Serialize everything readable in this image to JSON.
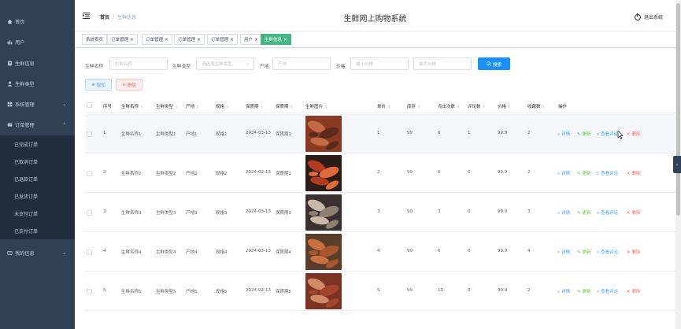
{
  "sidebar": {
    "items": [
      {
        "label": "首页",
        "icon": "home-icon"
      },
      {
        "label": "用户",
        "icon": "user-group-icon"
      },
      {
        "label": "生鲜信息",
        "icon": "document-icon"
      },
      {
        "label": "生鲜类型",
        "icon": "person-icon"
      },
      {
        "label": "系统管理",
        "icon": "grid-icon"
      },
      {
        "label": "订单管理",
        "icon": "order-icon"
      }
    ],
    "order_sub": [
      "已完成订单",
      "已取消订单",
      "已退款订单",
      "已发货订单",
      "未支付订单",
      "已支付订单"
    ],
    "my_info": "我的信息"
  },
  "header": {
    "breadcrumb_home": "首页",
    "breadcrumb_current": "生鲜信息",
    "title": "生鲜网上购物系统",
    "logout": "退出系统"
  },
  "tags": [
    "系统首页",
    "订单管理",
    "订单管理",
    "订单管理",
    "订单管理",
    "用户",
    "生鲜信息"
  ],
  "search": {
    "name_label": "生鲜名称",
    "name_placeholder": "生鲜名称",
    "type_label": "生鲜类型",
    "type_placeholder": "请选择生鲜类型",
    "origin_label": "产地",
    "origin_placeholder": "产地",
    "price_label": "价格",
    "min_price_placeholder": "最小价格",
    "max_price_placeholder": "最大价格",
    "search_btn": "搜索"
  },
  "toolbar": {
    "add": "增加",
    "delete": "删除"
  },
  "table": {
    "headers": [
      "序号",
      "生鲜名称",
      "生鲜类型",
      "产地",
      "规格",
      "保质期",
      "保质期",
      "生鲜图片",
      "单价",
      "库存",
      "点击次数",
      "评论数",
      "价格",
      "收藏数",
      "操作"
    ],
    "rows": [
      [
        "1",
        "生鲜名称1",
        "生鲜类型1",
        "产地1",
        "规格1",
        "2024-03-13",
        "保质期1",
        "1",
        "99",
        "6",
        "1",
        "99.9",
        "2"
      ],
      [
        "2",
        "生鲜名称2",
        "生鲜类型2",
        "产地2",
        "规格2",
        "2024-03-13",
        "保质期2",
        "2",
        "99",
        "6",
        "0",
        "99.9",
        "2"
      ],
      [
        "3",
        "生鲜名称3",
        "生鲜类型3",
        "产地3",
        "规格3",
        "2024-03-13",
        "保质期3",
        "3",
        "99",
        "3",
        "0",
        "99.9",
        "3"
      ],
      [
        "4",
        "生鲜名称4",
        "生鲜类型4",
        "产地4",
        "规格4",
        "2024-03-13",
        "保质期4",
        "4",
        "99",
        "6",
        "0",
        "99.9",
        "4"
      ],
      [
        "5",
        "生鲜名称5",
        "生鲜类型5",
        "产地5",
        "规格5",
        "2024-03-13",
        "保质期5",
        "5",
        "99",
        "10",
        "0",
        "99.9",
        "2"
      ]
    ],
    "actions": [
      "详情",
      "更新",
      "查看评论",
      "删除"
    ]
  },
  "colors": {
    "sidebar_bg": "#304156",
    "active_tag": "#42b983",
    "primary": "#1890ff"
  }
}
